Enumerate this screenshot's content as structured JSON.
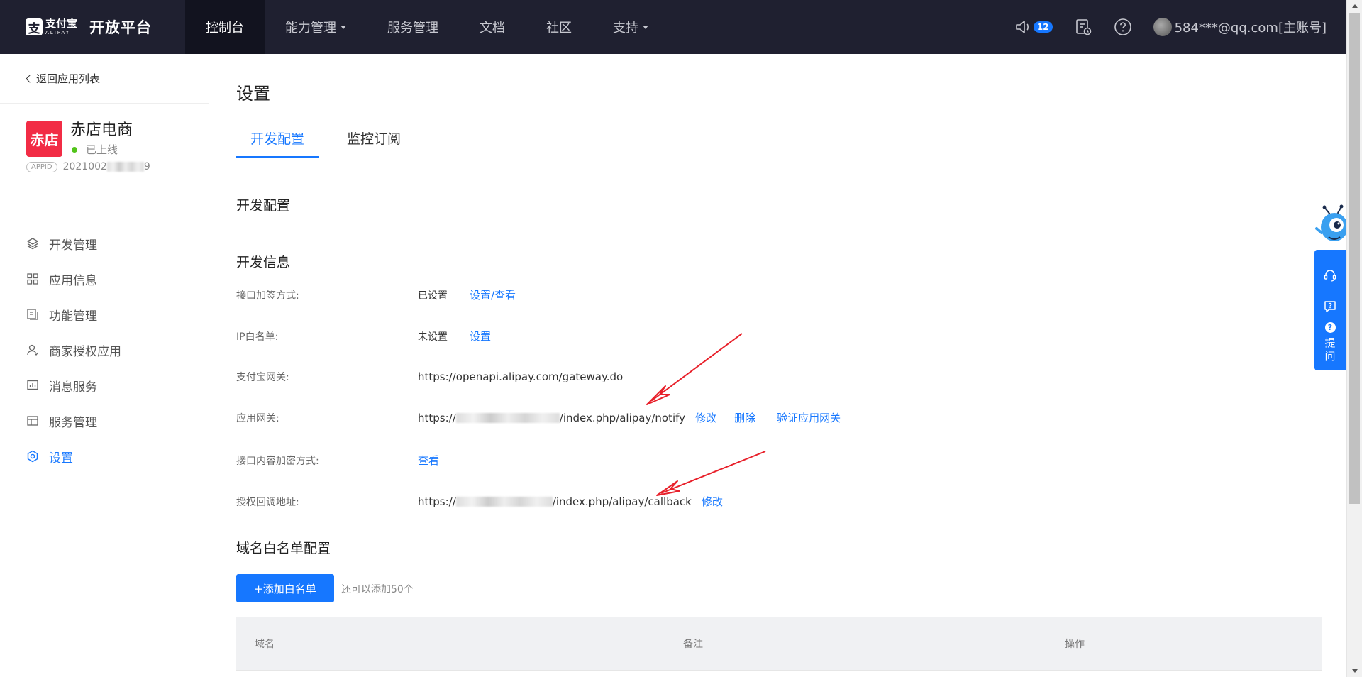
{
  "topbar": {
    "logo_cn": "支付宝",
    "logo_en": "ALIPAY",
    "logo_mark": "支",
    "platform_title": "开放平台",
    "nav": [
      {
        "label": "控制台"
      },
      {
        "label": "能力管理"
      },
      {
        "label": "服务管理"
      },
      {
        "label": "文档"
      },
      {
        "label": "社区"
      },
      {
        "label": "支持"
      }
    ],
    "notification_count": "12",
    "user_label": "584***@qq.com[主账号]"
  },
  "sidebar": {
    "back_label": "返回应用列表",
    "app": {
      "logo_text": "赤店",
      "name": "赤店电商",
      "status": "已上线",
      "appid_tag": "APPID",
      "appid_prefix": "2021002",
      "appid_suffix": "9"
    },
    "menu": [
      {
        "label": "开发管理",
        "icon": "layers-icon"
      },
      {
        "label": "应用信息",
        "icon": "apps-grid-icon"
      },
      {
        "label": "功能管理",
        "icon": "document-stack-icon"
      },
      {
        "label": "商家授权应用",
        "icon": "user-icon"
      },
      {
        "label": "消息服务",
        "icon": "chart-bars-icon"
      },
      {
        "label": "服务管理",
        "icon": "panel-icon"
      },
      {
        "label": "设置",
        "icon": "gear-icon"
      }
    ]
  },
  "main": {
    "page_title": "设置",
    "tabs": [
      {
        "label": "开发配置"
      },
      {
        "label": "监控订阅"
      }
    ],
    "section_dev_config": "开发配置",
    "section_dev_info": "开发信息",
    "rows": {
      "sign_method": {
        "label": "接口加签方式:",
        "value": "已设置",
        "link": "设置/查看"
      },
      "ip_whitelist": {
        "label": "IP白名单:",
        "value": "未设置",
        "link": "设置"
      },
      "alipay_gateway": {
        "label": "支付宝网关:",
        "value": "https://openapi.alipay.com/gateway.do"
      },
      "app_gateway": {
        "label": "应用网关:",
        "value_prefix": "https://",
        "value_suffix": "/index.php/alipay/notify",
        "link_edit": "修改",
        "link_delete": "删除",
        "link_verify": "验证应用网关"
      },
      "content_encrypt": {
        "label": "接口内容加密方式:",
        "link": "查看"
      },
      "auth_callback": {
        "label": "授权回调地址:",
        "value_prefix": "https://",
        "value_suffix": "/index.php/alipay/callback",
        "link_edit": "修改"
      }
    },
    "section_domain_whitelist": "域名白名单配置",
    "add_whitelist_button": "+添加白名单",
    "add_hint": "还可以添加50个",
    "table_headers": [
      "域名",
      "备注",
      "操作"
    ]
  },
  "float_widget": {
    "ask_label_1": "提",
    "ask_label_2": "问"
  },
  "colors": {
    "topbar_bg": "#1f2030",
    "accent": "#1677ff",
    "app_logo": "#f22c45",
    "annotation_arrow": "#e8202a"
  }
}
